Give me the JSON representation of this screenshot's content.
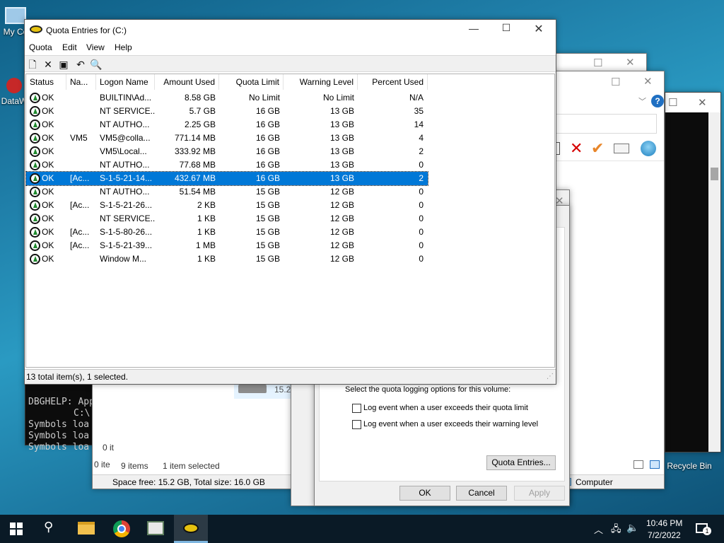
{
  "desktop": {
    "icons": [
      {
        "label": "My Co"
      },
      {
        "label": "DataW"
      },
      {
        "label": "Recycle Bin"
      }
    ]
  },
  "console": {
    "lines": [
      "DBGHELP: App",
      "C:\\",
      "Symbols loa",
      "Symbols loa",
      "Symbols loa"
    ]
  },
  "explorer": {
    "size_fragment": "15.2",
    "items_fragment": "0 it",
    "items_fragment2": "0 ite",
    "status_items": "9 items",
    "status_selected": "1 item selected",
    "space": "Space free: 15.2 GB, Total size: 16.0 GB",
    "computer": "Computer"
  },
  "properties": {
    "logging_heading": "Select the quota logging options for this volume:",
    "check1": "Log event when a user exceeds their quota limit",
    "check2": "Log event when a user exceeds their warning level",
    "quota_entries_btn": "Quota Entries...",
    "ok": "OK",
    "cancel": "Cancel",
    "apply": "Apply"
  },
  "quota_window": {
    "title": "Quota Entries for  (C:)",
    "menus": [
      "Quota",
      "Edit",
      "View",
      "Help"
    ],
    "columns": [
      "Status",
      "Na...",
      "Logon Name",
      "Amount Used",
      "Quota Limit",
      "Warning Level",
      "Percent Used"
    ],
    "rows": [
      {
        "status": "OK",
        "name": "",
        "logon": "BUILTIN\\Ad...",
        "amount": "8.58 GB",
        "limit": "No Limit",
        "warning": "No Limit",
        "percent": "N/A"
      },
      {
        "status": "OK",
        "name": "",
        "logon": "NT SERVICE...",
        "amount": "5.7 GB",
        "limit": "16 GB",
        "warning": "13 GB",
        "percent": "35"
      },
      {
        "status": "OK",
        "name": "",
        "logon": "NT AUTHO...",
        "amount": "2.25 GB",
        "limit": "16 GB",
        "warning": "13 GB",
        "percent": "14"
      },
      {
        "status": "OK",
        "name": "VM5",
        "logon": "VM5@colla...",
        "amount": "771.14 MB",
        "limit": "16 GB",
        "warning": "13 GB",
        "percent": "4"
      },
      {
        "status": "OK",
        "name": "",
        "logon": "VM5\\Local...",
        "amount": "333.92 MB",
        "limit": "16 GB",
        "warning": "13 GB",
        "percent": "2"
      },
      {
        "status": "OK",
        "name": "",
        "logon": "NT AUTHO...",
        "amount": "77.68 MB",
        "limit": "16 GB",
        "warning": "13 GB",
        "percent": "0"
      },
      {
        "status": "OK",
        "name": "[Ac...",
        "logon": "S-1-5-21-14...",
        "amount": "432.67 MB",
        "limit": "16 GB",
        "warning": "13 GB",
        "percent": "2"
      },
      {
        "status": "OK",
        "name": "",
        "logon": "NT AUTHO...",
        "amount": "51.54 MB",
        "limit": "15 GB",
        "warning": "12 GB",
        "percent": "0"
      },
      {
        "status": "OK",
        "name": "[Ac...",
        "logon": "S-1-5-21-26...",
        "amount": "2 KB",
        "limit": "15 GB",
        "warning": "12 GB",
        "percent": "0"
      },
      {
        "status": "OK",
        "name": "",
        "logon": "NT SERVICE...",
        "amount": "1 KB",
        "limit": "15 GB",
        "warning": "12 GB",
        "percent": "0"
      },
      {
        "status": "OK",
        "name": "[Ac...",
        "logon": "S-1-5-80-26...",
        "amount": "1 KB",
        "limit": "15 GB",
        "warning": "12 GB",
        "percent": "0"
      },
      {
        "status": "OK",
        "name": "[Ac...",
        "logon": "S-1-5-21-39...",
        "amount": "1 MB",
        "limit": "15 GB",
        "warning": "12 GB",
        "percent": "0"
      },
      {
        "status": "OK",
        "name": "",
        "logon": "Window M...",
        "amount": "1 KB",
        "limit": "15 GB",
        "warning": "12 GB",
        "percent": "0"
      }
    ],
    "status_text": "13 total item(s), 1 selected."
  },
  "taskbar": {
    "time": "10:46 PM",
    "date": "7/2/2022",
    "notification_count": "1"
  }
}
